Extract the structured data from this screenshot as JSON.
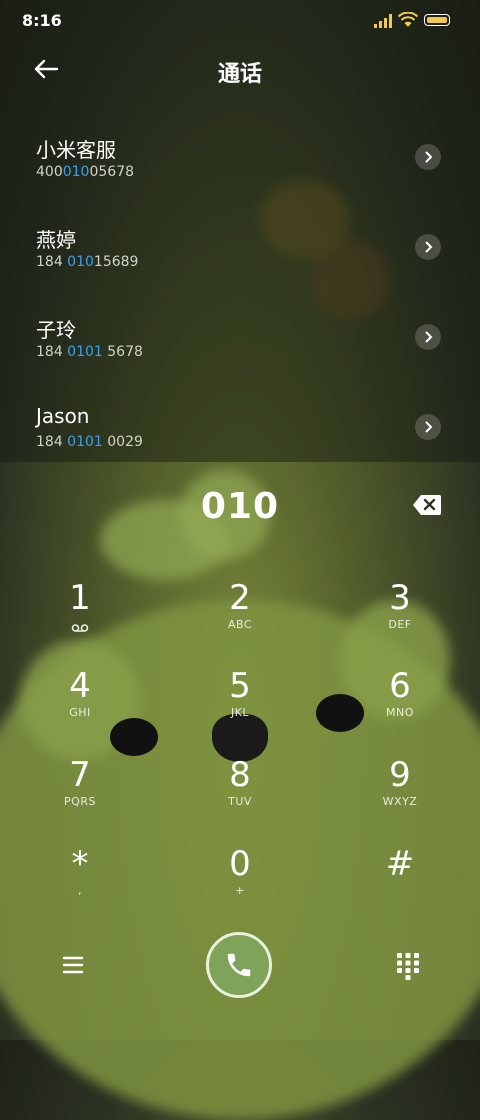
{
  "status": {
    "time": "8:16"
  },
  "header": {
    "title": "通话"
  },
  "contacts": [
    {
      "name": "小米客服",
      "pre": "400",
      "hl": "010",
      "post": "05678"
    },
    {
      "name": "燕婷",
      "pre": "184 ",
      "hl": "010",
      "post": "15689"
    },
    {
      "name": "子玲",
      "pre": "184 ",
      "hl": "0101",
      "post": " 5678"
    },
    {
      "name": "Jason",
      "pre": "184 ",
      "hl": "0101",
      "post": " 0029"
    }
  ],
  "dialer": {
    "input": "010",
    "keys": [
      {
        "digit": "1",
        "letters": ""
      },
      {
        "digit": "2",
        "letters": "ABC"
      },
      {
        "digit": "3",
        "letters": "DEF"
      },
      {
        "digit": "4",
        "letters": "GHI"
      },
      {
        "digit": "5",
        "letters": "JKL"
      },
      {
        "digit": "6",
        "letters": "MNO"
      },
      {
        "digit": "7",
        "letters": "PQRS"
      },
      {
        "digit": "8",
        "letters": "TUV"
      },
      {
        "digit": "9",
        "letters": "WXYZ"
      },
      {
        "digit": "*",
        "letters": ","
      },
      {
        "digit": "0",
        "letters": "+"
      },
      {
        "digit": "#",
        "letters": ""
      }
    ]
  },
  "icons": {
    "voicemail": "voicemail-icon",
    "menu": "menu-icon",
    "call": "phone-icon",
    "keypad": "keypad-icon",
    "back": "back-arrow-icon",
    "backspace": "backspace-icon"
  },
  "colors": {
    "highlight": "#3aa0e8",
    "call": "#7fa35a"
  }
}
